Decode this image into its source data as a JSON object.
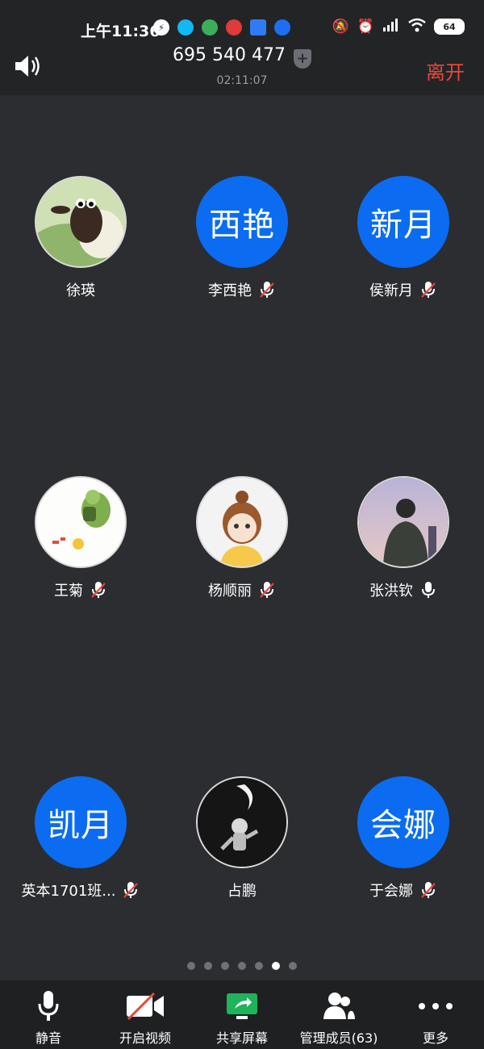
{
  "status_bar": {
    "time": "上午11:36",
    "battery": "64"
  },
  "meeting": {
    "id": "695 540 477",
    "duration": "02:11:07",
    "leave_label": "离开"
  },
  "participants": [
    {
      "name": "徐瑛",
      "avatar_text": "",
      "avatar_kind": "sheep",
      "mic": "none"
    },
    {
      "name": "李西艳",
      "avatar_text": "西艳",
      "avatar_kind": "text",
      "mic": "muted"
    },
    {
      "name": "侯新月",
      "avatar_text": "新月",
      "avatar_kind": "text",
      "mic": "muted"
    },
    {
      "name": "王菊",
      "avatar_text": "",
      "avatar_kind": "dino",
      "mic": "muted"
    },
    {
      "name": "杨顺丽",
      "avatar_text": "",
      "avatar_kind": "girl",
      "mic": "muted"
    },
    {
      "name": "张洪钦",
      "avatar_text": "",
      "avatar_kind": "photo",
      "mic": "on"
    },
    {
      "name": "英本1701班...",
      "avatar_text": "凯月",
      "avatar_kind": "text",
      "mic": "muted"
    },
    {
      "name": "占鹏",
      "avatar_text": "",
      "avatar_kind": "astronaut",
      "mic": "none"
    },
    {
      "name": "于会娜",
      "avatar_text": "会娜",
      "avatar_kind": "text",
      "mic": "muted"
    }
  ],
  "pagination": {
    "total": 7,
    "active_index": 5
  },
  "toolbar": {
    "mute": "静音",
    "video": "开启视频",
    "share": "共享屏幕",
    "members": "管理成员(63)",
    "more": "更多"
  },
  "colors": {
    "accent_blue": "#0b6cf2",
    "leave_red": "#e8473c",
    "share_green": "#1fb35b"
  }
}
